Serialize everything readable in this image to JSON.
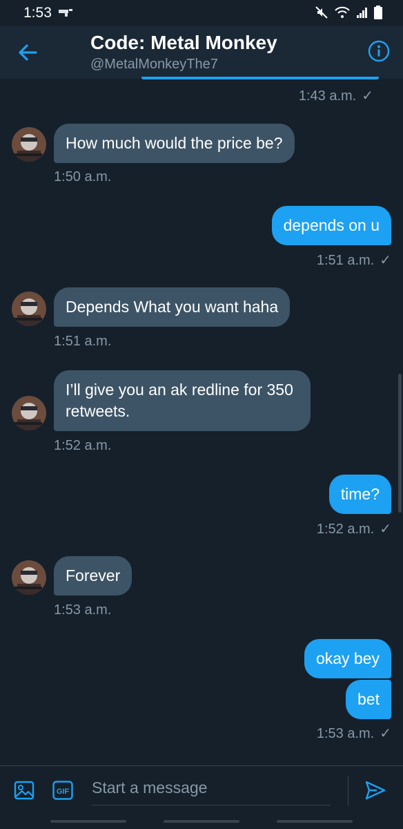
{
  "status": {
    "time": "1:53"
  },
  "header": {
    "title": "Code: Metal Monkey",
    "handle": "@MetalMonkeyThe7"
  },
  "messages": [
    {
      "meta": "1:43 a.m."
    },
    {
      "text": "How much would the price be?",
      "meta": "1:50 a.m."
    },
    {
      "text": "depends on u",
      "meta": "1:51 a.m."
    },
    {
      "text": "Depends What you want haha",
      "meta": "1:51 a.m."
    },
    {
      "text": "I’ll give you an ak redline for 350 retweets.",
      "meta": "1:52 a.m."
    },
    {
      "text": "time?",
      "meta": "1:52 a.m."
    },
    {
      "text": "Forever",
      "meta": "1:53 a.m."
    },
    {
      "text": "okay bey"
    },
    {
      "text": "bet",
      "meta": "1:53 a.m."
    }
  ],
  "composer": {
    "placeholder": "Start a message",
    "gif_label": "GIF"
  },
  "read_mark": "✓",
  "colors": {
    "accent": "#1da1f2",
    "background": "#15202b",
    "incoming": "#3d5466",
    "muted": "#8899a6"
  }
}
